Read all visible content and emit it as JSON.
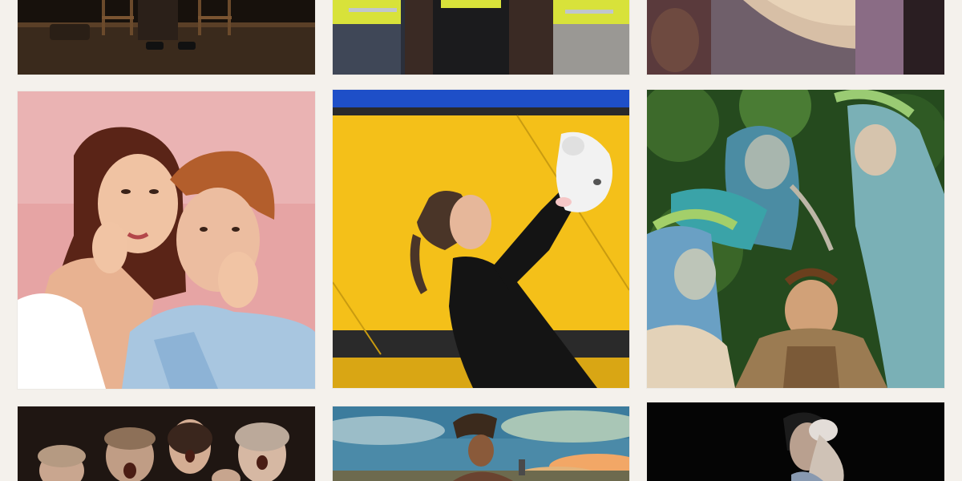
{
  "gallery": {
    "background": "#f4f1ec",
    "tiles": [
      {
        "id": "tile-1",
        "icon": "stage-chairs-image"
      },
      {
        "id": "tile-2",
        "icon": "hi-vis-workers-image"
      },
      {
        "id": "tile-3",
        "icon": "blonde-figure-image"
      },
      {
        "id": "tile-4",
        "icon": "couple-pink-backdrop-image"
      },
      {
        "id": "tile-5",
        "icon": "woman-lamb-mask-image"
      },
      {
        "id": "tile-6",
        "icon": "forest-nymphs-image"
      },
      {
        "id": "tile-7",
        "icon": "screaming-women-image"
      },
      {
        "id": "tile-8",
        "icon": "sky-figure-image"
      },
      {
        "id": "tile-9",
        "icon": "dark-dancer-image"
      }
    ]
  }
}
